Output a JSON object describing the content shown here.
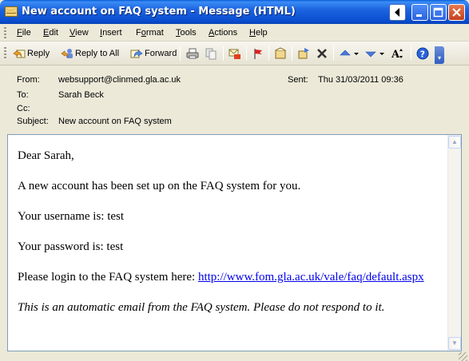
{
  "window": {
    "title": "New account on FAQ system - Message (HTML)"
  },
  "menu": {
    "items": [
      "File",
      "Edit",
      "View",
      "Insert",
      "Format",
      "Tools",
      "Actions",
      "Help"
    ],
    "accel": [
      "F",
      "E",
      "V",
      "I",
      "o",
      "T",
      "A",
      "H"
    ]
  },
  "toolbar": {
    "reply": "Reply",
    "reply_all": "Reply to All",
    "forward": "Forward",
    "icons": [
      "reply-icon",
      "reply-all-icon",
      "forward-icon",
      "print-icon",
      "copy-icon",
      "move-to-folder-icon",
      "flag-icon",
      "address-book-icon",
      "move-icon",
      "delete-icon",
      "previous-item-icon",
      "next-item-icon",
      "font-size-icon",
      "help-icon"
    ]
  },
  "header": {
    "from_label": "From:",
    "from_value": "websupport@clinmed.gla.ac.uk",
    "sent_label": "Sent:",
    "sent_value": "Thu 31/03/2011 09:36",
    "to_label": "To:",
    "to_value": "Sarah Beck",
    "cc_label": "Cc:",
    "cc_value": "",
    "subject_label": "Subject:",
    "subject_value": "New account on FAQ system"
  },
  "message": {
    "greeting": "Dear Sarah,",
    "line1": "A new account has been set up on the FAQ system for you.",
    "username_line": "Your username is: test",
    "password_line": "Your password is: test",
    "login_prefix": "Please login to the FAQ system here: ",
    "login_url": "http://www.fom.gla.ac.uk/vale/faq/default.aspx",
    "footer": "This is an automatic email from the FAQ system. Please do not respond to it."
  },
  "colors": {
    "titlebar": "#0a4fd0",
    "link": "#0000ee",
    "chrome": "#ece9d8"
  }
}
